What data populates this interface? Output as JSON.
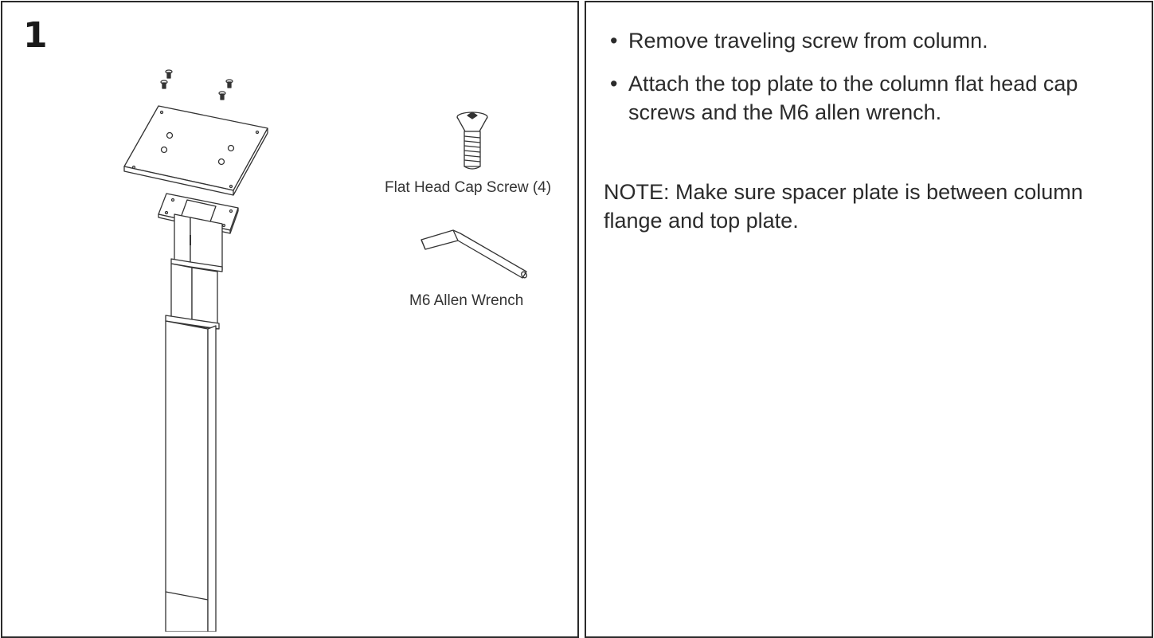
{
  "step": {
    "number": "1"
  },
  "figure": {
    "screw_label": "Flat Head Cap Screw (4)",
    "wrench_label": "M6 Allen Wrench",
    "icons": [
      "flat-head-cap-screw-icon",
      "allen-wrench-icon",
      "top-plate-icon",
      "column-icon",
      "spacer-plate-icon"
    ]
  },
  "instructions": {
    "items": [
      "Remove traveling screw from column.",
      "Attach the top plate to the column flat head cap screws and the M6 allen wrench."
    ],
    "note": "NOTE: Make sure spacer plate is between column flange and top plate."
  },
  "colors": {
    "border": "#2a2a2a",
    "text": "#2b2b2b",
    "line_art": "#333333"
  }
}
